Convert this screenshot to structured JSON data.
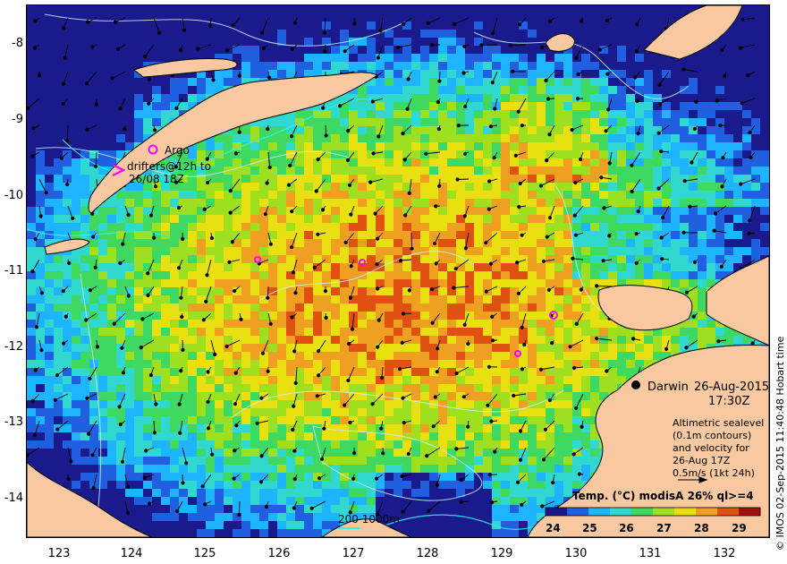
{
  "map": {
    "lon_range": [
      122.6,
      132.6
    ],
    "lat_range": [
      -14.6,
      -7.6
    ],
    "lon_ticks": [
      "123",
      "124",
      "125",
      "126",
      "127",
      "128",
      "129",
      "130",
      "131",
      "132"
    ],
    "lat_ticks": [
      "-8",
      "-9",
      "-10",
      "-11",
      "-12",
      "-13",
      "-14"
    ]
  },
  "legend": {
    "argo_label": "Argo",
    "drifters_line1": "drifters@12h to",
    "drifters_line2": "26/08 18Z"
  },
  "place": {
    "city": "Darwin",
    "date": "26-Aug-2015",
    "time": "17:30Z"
  },
  "info": {
    "lines": [
      "Altimetric sealevel",
      "(0.1m contours)",
      "and velocity for",
      "26-Aug 17Z",
      "0.5m/s (1kt 24h)"
    ]
  },
  "scale_bar": {
    "label": "200  1000m"
  },
  "colorbar": {
    "title": "Temp. (°C) modisA 26% ql>=4",
    "ticks": [
      "24",
      "25",
      "26",
      "27",
      "28",
      "29"
    ],
    "colors": [
      "#1a1a8c",
      "#1f5fe0",
      "#1fb4ff",
      "#30d8d0",
      "#3fd860",
      "#9ee020",
      "#e8e010",
      "#f0a020",
      "#e05010",
      "#a01010"
    ]
  },
  "credit": "© IMOS 02-Sep-2015 11:40:48 Hobart time",
  "palette": {
    "land": "#f8c8a0",
    "sea_base": "#3fc83c"
  }
}
